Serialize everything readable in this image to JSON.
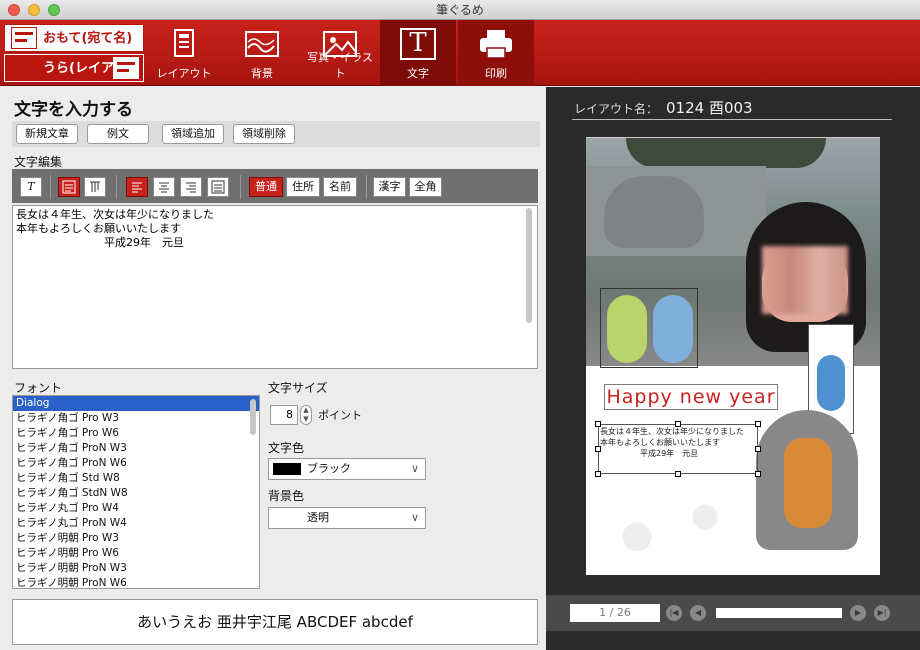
{
  "window": {
    "title": "筆ぐるめ"
  },
  "toolbar": {
    "side_front": "おもて(宛て名)",
    "side_back": "うら(レイアウト)",
    "tabs": [
      {
        "label": "レイアウト",
        "icon": "layout-icon"
      },
      {
        "label": "背景",
        "icon": "background-icon"
      },
      {
        "label": "写真・イラスト",
        "icon": "photo-icon"
      },
      {
        "label": "文字",
        "icon": "text-icon",
        "glyph": "T"
      },
      {
        "label": "印刷",
        "icon": "printer-icon"
      }
    ],
    "accent": "#c8221c",
    "active_tab": "文字"
  },
  "editor": {
    "heading": "文字を入力する",
    "buttons": [
      "新規文章",
      "例文",
      "領域追加",
      "領域削除"
    ],
    "edit_label": "文字編集",
    "italic_glyph": "T",
    "tools": {
      "normal": "普通",
      "address": "住所",
      "name": "名前",
      "kanji": "漢字",
      "fullwidth": "全角"
    },
    "text": "長女は４年生、次女は年少になりました\n本年もよろしくお願いいたします\n　　　　　　　　平成29年　元旦",
    "font_label": "フォント",
    "fonts": [
      "Dialog",
      "ヒラギノ角ゴ Pro W3",
      "ヒラギノ角ゴ Pro W6",
      "ヒラギノ角ゴ ProN W3",
      "ヒラギノ角ゴ ProN W6",
      "ヒラギノ角ゴ Std W8",
      "ヒラギノ角ゴ StdN W8",
      "ヒラギノ丸ゴ Pro W4",
      "ヒラギノ丸ゴ ProN W4",
      "ヒラギノ明朝 Pro W3",
      "ヒラギノ明朝 Pro W6",
      "ヒラギノ明朝 ProN W3",
      "ヒラギノ明朝 ProN W6"
    ],
    "selected_font": "Dialog",
    "size_label": "文字サイズ",
    "size_value": "8",
    "size_unit": "ポイント",
    "color_label": "文字色",
    "color_value": "ブラック",
    "color_hex": "#000000",
    "bg_label": "背景色",
    "bg_value": "透明",
    "preview": "あいうえお 亜井宇江尾 ABCDEF abcdef"
  },
  "layout": {
    "label": "レイアウト名：",
    "name": "0124 酉003",
    "greeting": "Happy new year",
    "card_text": "長女は４年生、次女は年少になりました\n本年もよろしくお願いいたします\n　　　　　平成29年　元旦",
    "page": "1 / 26"
  }
}
